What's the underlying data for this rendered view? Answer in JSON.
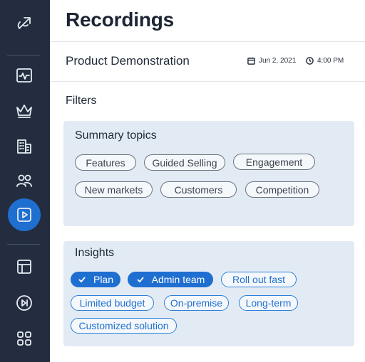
{
  "sidebar": {
    "items": [
      {
        "name": "logo-icon"
      },
      {
        "name": "activity-icon"
      },
      {
        "name": "crown-icon"
      },
      {
        "name": "building-icon"
      },
      {
        "name": "users-icon"
      },
      {
        "name": "play-icon",
        "active": true
      },
      {
        "name": "layout-icon"
      },
      {
        "name": "skip-forward-icon"
      },
      {
        "name": "apps-icon"
      }
    ]
  },
  "header": {
    "title": "Recordings"
  },
  "recording": {
    "title": "Product Demonstration",
    "date": "Jun 2, 2021",
    "time": "4:00 PM"
  },
  "filters": {
    "label": "Filters",
    "summary_topics": {
      "title": "Summary topics",
      "chips": [
        "Features",
        "Guided Selling",
        "Engagement",
        "New markets",
        "Customers",
        "Competition"
      ]
    },
    "insights": {
      "title": "Insights",
      "chips": [
        "Plan",
        "Admin team",
        "Roll out fast",
        "Limited budget",
        "On-premise",
        "Long-term",
        "Customized solution"
      ],
      "selected": [
        "Plan",
        "Admin team"
      ]
    }
  },
  "colors": {
    "sidebar_bg": "#232d3f",
    "accent": "#1f6fd1",
    "panel_bg": "#e2ebf4"
  }
}
